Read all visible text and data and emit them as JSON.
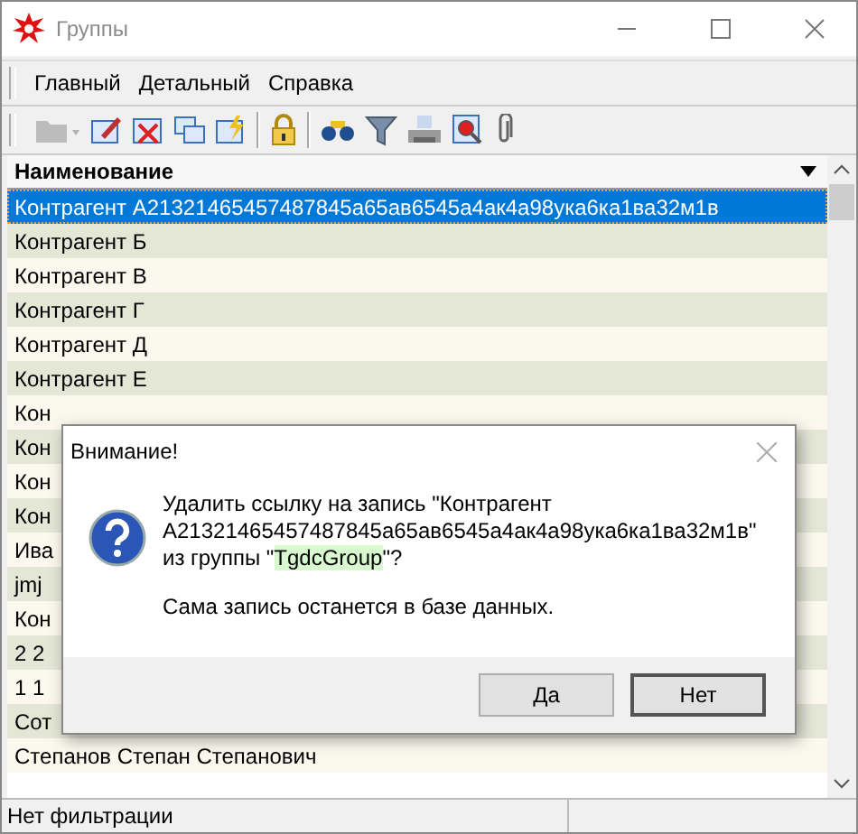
{
  "window": {
    "title": "Группы"
  },
  "menu": [
    "Главный",
    "Детальный",
    "Справка"
  ],
  "toolbar": [
    {
      "kind": "folder",
      "disabled": true
    },
    {
      "kind": "edit"
    },
    {
      "kind": "delete"
    },
    {
      "kind": "copy"
    },
    {
      "kind": "lightning"
    },
    {
      "kind": "sep"
    },
    {
      "kind": "lock"
    },
    {
      "kind": "sep"
    },
    {
      "kind": "binoculars"
    },
    {
      "kind": "filter"
    },
    {
      "kind": "printer"
    },
    {
      "kind": "find"
    },
    {
      "kind": "clip"
    }
  ],
  "table": {
    "columns": [
      "Наименование"
    ],
    "rows": [
      {
        "name": "Контрагент А21321465457487845а65ав6545а4ак4а98ука6ка1ва32м1в",
        "selected": true
      },
      {
        "name": "Контрагент Б",
        "selected": false
      },
      {
        "name": "Контрагент В",
        "selected": false
      },
      {
        "name": "Контрагент Г",
        "selected": false
      },
      {
        "name": "Контрагент Д",
        "selected": false
      },
      {
        "name": "Контрагент Е",
        "selected": false
      },
      {
        "name": "Кон",
        "selected": false
      },
      {
        "name": "Кон",
        "selected": false
      },
      {
        "name": "Кон",
        "selected": false
      },
      {
        "name": "Кон",
        "selected": false
      },
      {
        "name": "Ива",
        "selected": false
      },
      {
        "name": "jmj",
        "selected": false
      },
      {
        "name": "Кон",
        "selected": false
      },
      {
        "name": "2 2",
        "selected": false
      },
      {
        "name": "1 1",
        "selected": false
      },
      {
        "name": "Сот",
        "selected": false
      },
      {
        "name": "Степанов Степан Степанович",
        "selected": false
      }
    ]
  },
  "dialog": {
    "title": "Внимание!",
    "message": {
      "before": "Удалить ссылку на запись \"Контрагент А21321465457487845а65ав6545а4ак4а98ука6ка1ва32м1в\" из группы \"",
      "highlight": "TgdcGroup",
      "after": "\"?"
    },
    "note": "Сама запись останется в базе данных.",
    "buttons": [
      {
        "label": "Да",
        "default": false
      },
      {
        "label": "Нет",
        "default": true
      }
    ]
  },
  "status_bar": "Нет фильтрации"
}
